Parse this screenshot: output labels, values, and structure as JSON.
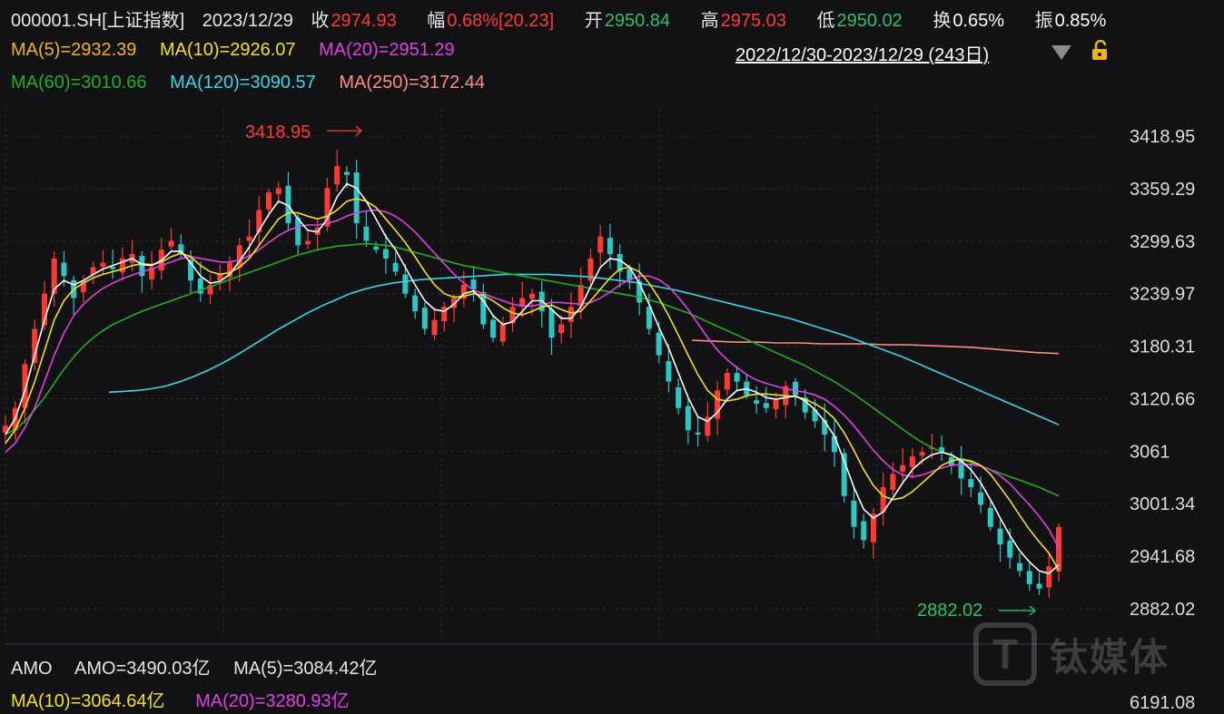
{
  "header": {
    "symbol": "000001.SH[上证指数]",
    "date": "2023/12/29",
    "close_label": "收",
    "close": "2974.93",
    "amp_label": "幅",
    "change_pct": "0.68%[20.23]",
    "open_label": "开",
    "open": "2950.84",
    "high_label": "高",
    "high": "2975.03",
    "low_label": "低",
    "low": "2950.02",
    "turnover_label": "换",
    "turnover": "0.65%",
    "swing_label": "振",
    "swing": "0.85%"
  },
  "ma_legend": {
    "ma5": "MA(5)=2932.39",
    "ma10": "MA(10)=2926.07",
    "ma20": "MA(20)=2951.29",
    "ma60": "MA(60)=3010.66",
    "ma120": "MA(120)=3090.57",
    "ma250": "MA(250)=3172.44"
  },
  "range": {
    "text": "2022/12/30-2023/12/29 (243日)"
  },
  "amo": {
    "title": "AMO",
    "amo": "AMO=3490.03亿",
    "ma5": "MA(5)=3084.42亿",
    "ma10": "MA(10)=3064.64亿",
    "ma20": "MA(20)=3280.93亿"
  },
  "watermark": {
    "mark": "T",
    "text": "钛媒体"
  },
  "bottom_tick": "6191.08",
  "colors": {
    "up": "#ff3b30",
    "down": "#2ec5c5",
    "ma5": "#ffffff",
    "ma10": "#f2e022",
    "ma20": "#e040e0",
    "ma60": "#1eb01e",
    "ma120": "#3ad6e6",
    "ma250": "#ff8c82"
  },
  "chart_data": {
    "type": "candlestick",
    "ylim": [
      2850,
      3450
    ],
    "yticks": [
      "3418.95",
      "3359.29",
      "3299.63",
      "3239.97",
      "3180.31",
      "3120.66",
      "3061",
      "3001.34",
      "2941.68",
      "2882.02"
    ],
    "high_annotation": "3418.95",
    "low_annotation": "2882.02",
    "close_path": [
      3090,
      3110,
      3160,
      3200,
      3240,
      3280,
      3260,
      3235,
      3255,
      3270,
      3275,
      3268,
      3280,
      3285,
      3260,
      3270,
      3290,
      3300,
      3285,
      3255,
      3240,
      3250,
      3262,
      3275,
      3295,
      3305,
      3335,
      3355,
      3360,
      3320,
      3295,
      3300,
      3315,
      3360,
      3385,
      3375,
      3320,
      3300,
      3290,
      3280,
      3265,
      3240,
      3220,
      3200,
      3210,
      3225,
      3235,
      3250,
      3245,
      3205,
      3190,
      3205,
      3225,
      3235,
      3240,
      3220,
      3190,
      3205,
      3225,
      3250,
      3280,
      3305,
      3285,
      3265,
      3255,
      3230,
      3200,
      3170,
      3140,
      3110,
      3085,
      3080,
      3100,
      3130,
      3150,
      3140,
      3125,
      3115,
      3110,
      3120,
      3135,
      3125,
      3105,
      3095,
      3080,
      3060,
      3010,
      2975,
      2960,
      2990,
      3020,
      3035,
      3045,
      3055,
      3060,
      3065,
      3060,
      3045,
      3030,
      3020,
      3000,
      2975,
      2955,
      2940,
      2925,
      2910,
      2905,
      2930,
      2975
    ],
    "ma5_path": [
      3080,
      3098,
      3130,
      3170,
      3210,
      3245,
      3255,
      3250,
      3255,
      3262,
      3268,
      3272,
      3276,
      3280,
      3273,
      3272,
      3278,
      3288,
      3288,
      3275,
      3260,
      3252,
      3254,
      3262,
      3277,
      3293,
      3312,
      3330,
      3345,
      3340,
      3325,
      3312,
      3310,
      3325,
      3350,
      3365,
      3360,
      3345,
      3325,
      3305,
      3290,
      3270,
      3250,
      3232,
      3222,
      3220,
      3228,
      3240,
      3243,
      3232,
      3215,
      3205,
      3208,
      3220,
      3232,
      3232,
      3222,
      3212,
      3212,
      3225,
      3248,
      3270,
      3280,
      3278,
      3270,
      3252,
      3228,
      3202,
      3178,
      3150,
      3122,
      3100,
      3095,
      3105,
      3120,
      3130,
      3132,
      3128,
      3122,
      3120,
      3122,
      3124,
      3118,
      3108,
      3095,
      3078,
      3050,
      3020,
      2995,
      2985,
      2992,
      3008,
      3025,
      3040,
      3050,
      3057,
      3060,
      3057,
      3050,
      3040,
      3025,
      3006,
      2985,
      2965,
      2948,
      2935,
      2925,
      2922,
      2932
    ],
    "ma10_path": [
      3070,
      3085,
      3110,
      3140,
      3175,
      3210,
      3232,
      3245,
      3252,
      3258,
      3262,
      3265,
      3268,
      3272,
      3274,
      3273,
      3276,
      3282,
      3286,
      3282,
      3272,
      3265,
      3262,
      3264,
      3270,
      3280,
      3295,
      3310,
      3325,
      3332,
      3332,
      3328,
      3325,
      3328,
      3335,
      3345,
      3348,
      3345,
      3338,
      3325,
      3312,
      3298,
      3282,
      3265,
      3250,
      3240,
      3236,
      3237,
      3240,
      3238,
      3232,
      3224,
      3218,
      3216,
      3220,
      3225,
      3227,
      3222,
      3218,
      3220,
      3232,
      3245,
      3258,
      3268,
      3270,
      3265,
      3252,
      3235,
      3215,
      3193,
      3170,
      3148,
      3130,
      3120,
      3118,
      3120,
      3124,
      3126,
      3126,
      3125,
      3124,
      3123,
      3120,
      3115,
      3108,
      3098,
      3082,
      3062,
      3040,
      3022,
      3010,
      3006,
      3008,
      3015,
      3025,
      3035,
      3045,
      3050,
      3052,
      3050,
      3045,
      3035,
      3020,
      3005,
      2988,
      2972,
      2958,
      2945,
      2926
    ],
    "ma20_path": [
      3060,
      3070,
      3088,
      3110,
      3140,
      3170,
      3195,
      3215,
      3228,
      3238,
      3246,
      3252,
      3257,
      3261,
      3265,
      3268,
      3272,
      3276,
      3280,
      3282,
      3280,
      3278,
      3276,
      3276,
      3278,
      3283,
      3290,
      3298,
      3306,
      3312,
      3316,
      3318,
      3318,
      3320,
      3323,
      3328,
      3332,
      3334,
      3335,
      3333,
      3328,
      3320,
      3310,
      3298,
      3286,
      3274,
      3262,
      3252,
      3244,
      3240,
      3236,
      3232,
      3228,
      3226,
      3226,
      3228,
      3230,
      3230,
      3229,
      3228,
      3230,
      3235,
      3242,
      3250,
      3256,
      3260,
      3260,
      3256,
      3248,
      3236,
      3222,
      3206,
      3190,
      3176,
      3165,
      3156,
      3148,
      3142,
      3138,
      3135,
      3132,
      3130,
      3128,
      3125,
      3120,
      3112,
      3102,
      3090,
      3076,
      3062,
      3050,
      3040,
      3034,
      3032,
      3034,
      3038,
      3042,
      3045,
      3046,
      3046,
      3044,
      3040,
      3033,
      3024,
      3012,
      3000,
      2987,
      2972,
      2951
    ],
    "ma60_path": [
      3080,
      3086,
      3095,
      3108,
      3122,
      3138,
      3154,
      3168,
      3180,
      3190,
      3198,
      3205,
      3210,
      3215,
      3220,
      3224,
      3228,
      3232,
      3236,
      3240,
      3244,
      3248,
      3252,
      3256,
      3260,
      3264,
      3268,
      3272,
      3276,
      3280,
      3284,
      3287,
      3290,
      3292,
      3294,
      3295,
      3296,
      3297,
      3296,
      3295,
      3293,
      3290,
      3287,
      3284,
      3281,
      3278,
      3275,
      3272,
      3270,
      3268,
      3266,
      3264,
      3262,
      3260,
      3258,
      3256,
      3254,
      3252,
      3250,
      3248,
      3246,
      3244,
      3242,
      3240,
      3238,
      3236,
      3233,
      3230,
      3226,
      3222,
      3218,
      3213,
      3208,
      3203,
      3198,
      3193,
      3188,
      3183,
      3178,
      3173,
      3168,
      3163,
      3158,
      3152,
      3146,
      3140,
      3133,
      3126,
      3118,
      3110,
      3102,
      3094,
      3086,
      3078,
      3071,
      3065,
      3060,
      3056,
      3052,
      3048,
      3044,
      3040,
      3036,
      3032,
      3028,
      3024,
      3020,
      3015,
      3010
    ],
    "ma120_path": [
      3128,
      3129,
      3130,
      3132,
      3135,
      3140,
      3146,
      3153,
      3161,
      3170,
      3180,
      3190,
      3200,
      3209,
      3218,
      3226,
      3233,
      3240,
      3245,
      3249,
      3252,
      3254,
      3256,
      3257,
      3258,
      3259,
      3260,
      3261,
      3262,
      3262,
      3262,
      3262,
      3261,
      3260,
      3259,
      3257,
      3255,
      3253,
      3250,
      3247,
      3244,
      3240,
      3236,
      3232,
      3228,
      3224,
      3220,
      3216,
      3212,
      3207,
      3202,
      3197,
      3192,
      3186,
      3180,
      3174,
      3168,
      3161,
      3154,
      3147,
      3140,
      3133,
      3126,
      3119,
      3112,
      3105,
      3098,
      3091
    ],
    "ma250_path": [
      3187,
      3186,
      3185,
      3185,
      3184,
      3184,
      3183,
      3183,
      3183,
      3182,
      3182,
      3181,
      3180,
      3179,
      3177,
      3175,
      3173,
      3172
    ]
  }
}
